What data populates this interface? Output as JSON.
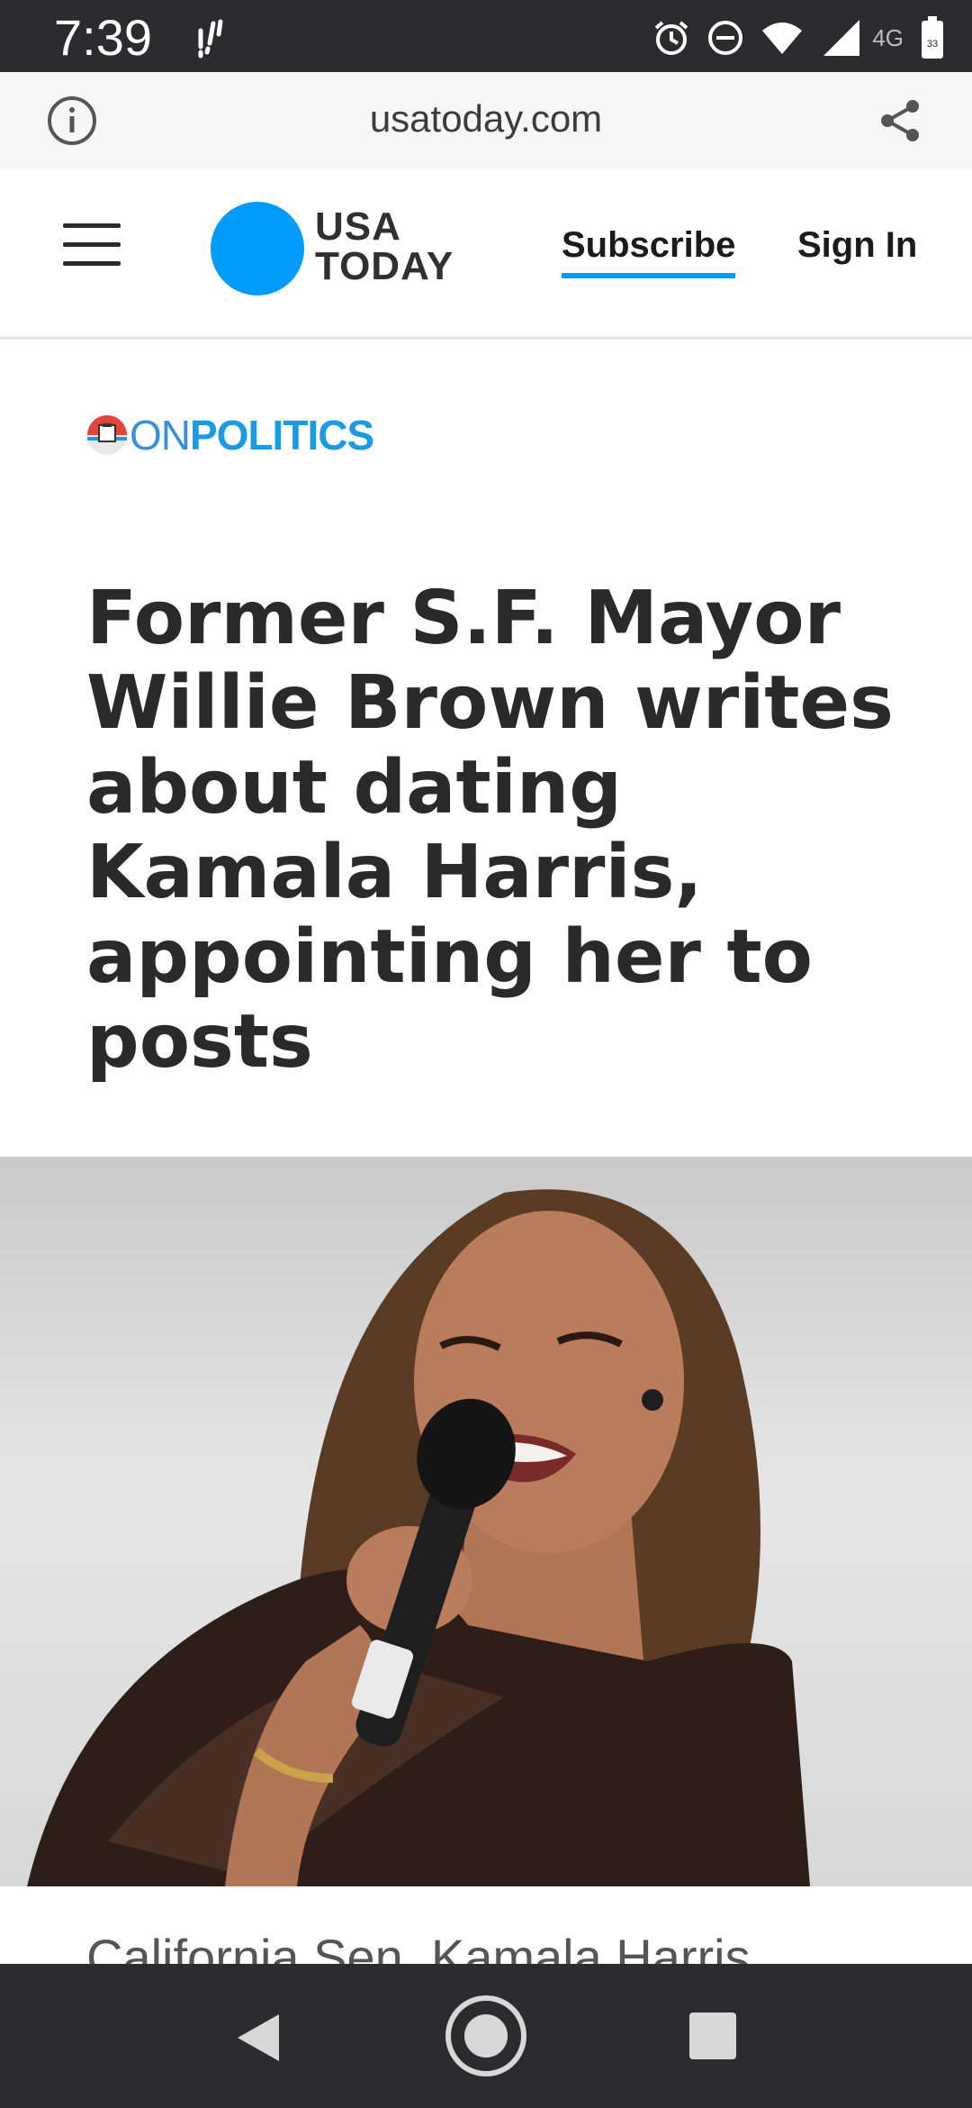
{
  "status_bar": {
    "time": "7:39",
    "network": "4G",
    "battery_level": "33"
  },
  "browser": {
    "url": "usatoday.com"
  },
  "site_header": {
    "logo_line1": "USA",
    "logo_line2": "TODAY",
    "subscribe": "Subscribe",
    "sign_in": "Sign In",
    "brand_color": "#009BFF"
  },
  "article": {
    "section_on": "ON",
    "section_politics": "POLITICS",
    "headline": "Former S.F. Mayor Willie Brown writes about dating Kamala Harris, appointing her to posts",
    "caption": "California Sen. Kamala Harris"
  }
}
